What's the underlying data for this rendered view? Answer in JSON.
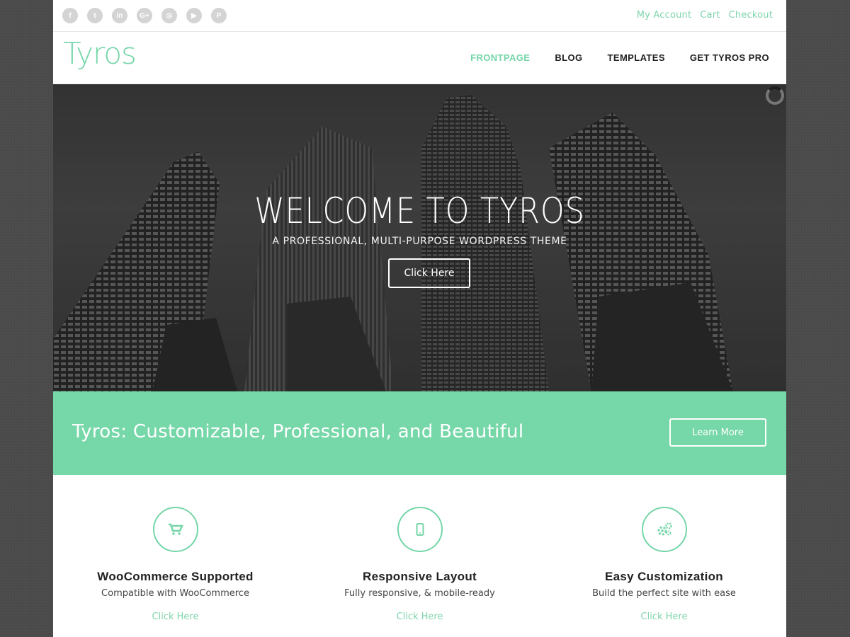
{
  "topbar": {
    "socials": [
      {
        "icon": "facebook-icon",
        "glyph": "f"
      },
      {
        "icon": "twitter-icon",
        "glyph": "t"
      },
      {
        "icon": "linkedin-icon",
        "glyph": "in"
      },
      {
        "icon": "google-plus-icon",
        "glyph": "G+"
      },
      {
        "icon": "instagram-icon",
        "glyph": "◎"
      },
      {
        "icon": "youtube-icon",
        "glyph": "▶"
      },
      {
        "icon": "pinterest-icon",
        "glyph": "P"
      }
    ],
    "links": [
      "My Account",
      "Cart",
      "Checkout"
    ]
  },
  "header": {
    "logo": "Tyros",
    "nav": [
      {
        "label": "FRONTPAGE",
        "active": true
      },
      {
        "label": "BLOG",
        "active": false
      },
      {
        "label": "TEMPLATES",
        "active": false
      },
      {
        "label": "GET TYROS PRO",
        "active": false
      }
    ]
  },
  "hero": {
    "title": "WELCOME TO TYROS",
    "subtitle": "A PROFESSIONAL, MULTI-PURPOSE WORDPRESS THEME",
    "button": "Click Here"
  },
  "band": {
    "text": "Tyros: Customizable, Professional, and Beautiful",
    "button": "Learn More"
  },
  "features": [
    {
      "icon": "cart-icon",
      "title": "WooCommerce Supported",
      "desc": "Compatible with WooCommerce",
      "link": "Click Here"
    },
    {
      "icon": "mobile-icon",
      "title": "Responsive Layout",
      "desc": "Fully responsive, & mobile-ready",
      "link": "Click Here"
    },
    {
      "icon": "gears-icon",
      "title": "Easy Customization",
      "desc": "Build the perfect site with ease",
      "link": "Click Here"
    }
  ],
  "colors": {
    "accent": "#75d6a8",
    "page_bg": "#4a4a4a"
  }
}
